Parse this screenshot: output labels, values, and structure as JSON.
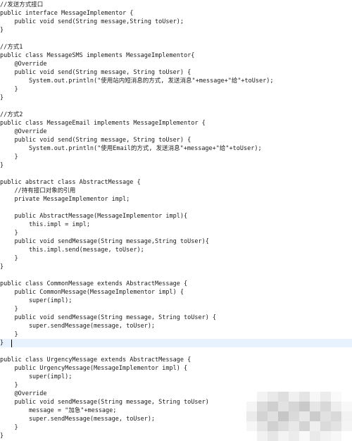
{
  "editor": {
    "lines": [
      "//发送方式接口",
      "public interface MessageImplementor {",
      "    public void send(String message,String toUser);",
      "}",
      "",
      "//方式1",
      "public class MessageSMS implements MessageImplementor{",
      "    @Override",
      "    public void send(String message, String toUser) {",
      "        System.out.println(\"使用站内短消息的方式, 发送消息\"+message+\"给\"+toUser);",
      "    }",
      "}",
      "",
      "//方式2",
      "public class MessageEmail implements MessageImplementor {",
      "    @Override",
      "    public void send(String message, String toUser) {",
      "        System.out.println(\"使用Email的方式, 发送消息\"+message+\"给\"+toUser);",
      "    }",
      "}",
      "",
      "public abstract class AbstractMessage {",
      "    //持有接口对象的引用",
      "    private MessageImplementor impl;",
      "",
      "    public AbstractMessage(MessageImplementor impl){",
      "        this.impl = impl;",
      "    }",
      "    public void sendMessage(String message,String toUser){",
      "        this.impl.send(message, toUser);",
      "    }",
      "}",
      "",
      "public class CommonMessage extends AbstractMessage {",
      "    public CommonMessage(MessageImplementor impl) {",
      "        super(impl);",
      "    }",
      "    public void sendMessage(String message, String toUser) {",
      "        super.sendMessage(message, toUser);",
      "    }",
      "} ",
      "",
      "public class UrgencyMessage extends AbstractMessage {",
      "    public UrgencyMessage(MessageImplementor impl) {",
      "        super(impl);",
      "    }",
      "    @Override",
      "    public void sendMessage(String message, String toUser)",
      "        message = \"加急\"+message;",
      "        super.sendMessage(message, toUser);",
      "    }",
      "}"
    ],
    "current_line_index": 40
  },
  "colors": {
    "text": "#1a1a1a",
    "current_line_highlight": "#e8f2ff",
    "background": "#ffffff"
  }
}
